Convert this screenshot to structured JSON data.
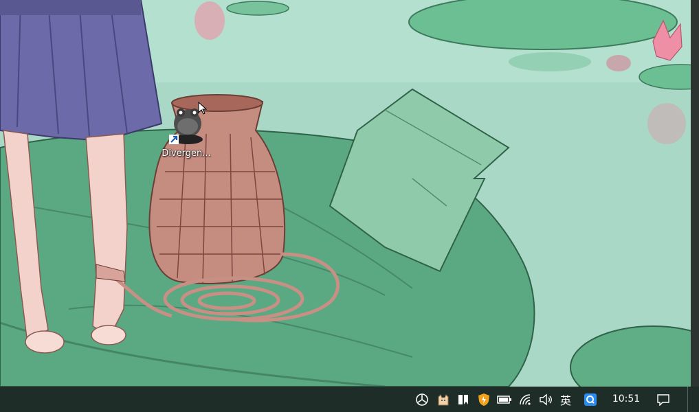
{
  "desktop": {
    "wallpaper": "illustrated-pond-scene",
    "shortcut": {
      "label": "Divergen...",
      "icon": "frog-figure-icon",
      "overlay": "shortcut-arrow-icon"
    }
  },
  "taskbar": {
    "tray_icons": [
      "network-hub-icon",
      "cat-app-icon",
      "bookmark-app-icon",
      "security-shield-icon",
      "battery-icon",
      "wifi-icon",
      "volume-icon",
      "ime-indicator",
      "search-app-icon"
    ],
    "ime_label": "英",
    "clock": "10:51",
    "notification_icon": "action-center-icon"
  },
  "colors": {
    "taskbar_bg": "#1f2d29",
    "water": "#a9d9c6",
    "leaf": "#5aa982"
  }
}
